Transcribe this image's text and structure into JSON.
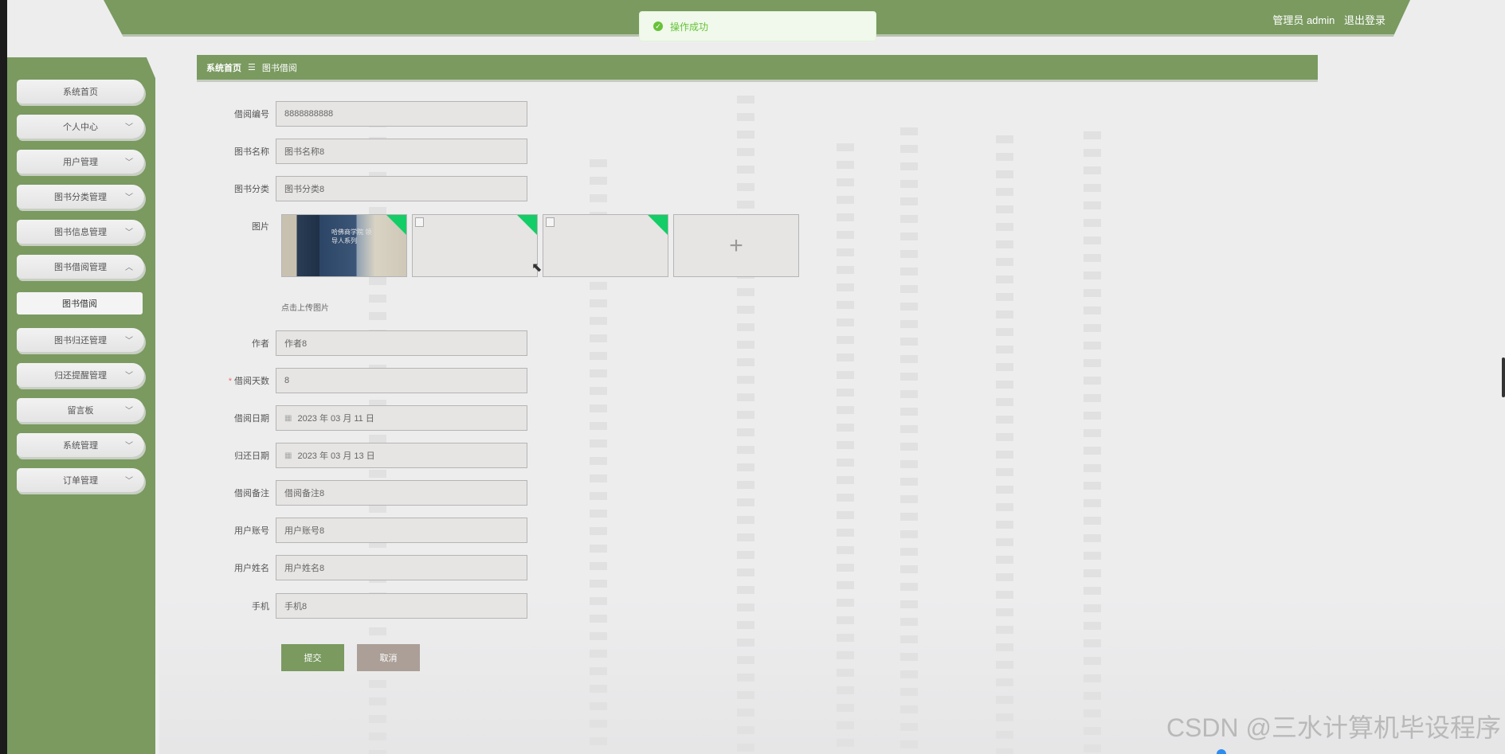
{
  "header": {
    "user_label": "管理员 admin",
    "logout": "退出登录"
  },
  "toast": {
    "message": "操作成功"
  },
  "sidebar": {
    "items": [
      {
        "label": "系统首页",
        "chevron": ""
      },
      {
        "label": "个人中心",
        "chevron": "﹀"
      },
      {
        "label": "用户管理",
        "chevron": "﹀"
      },
      {
        "label": "图书分类管理",
        "chevron": "﹀"
      },
      {
        "label": "图书信息管理",
        "chevron": "﹀"
      },
      {
        "label": "图书借阅管理",
        "chevron": "︿"
      },
      {
        "label": "图书借阅",
        "chevron": ""
      },
      {
        "label": "图书归还管理",
        "chevron": "﹀"
      },
      {
        "label": "归还提醒管理",
        "chevron": "﹀"
      },
      {
        "label": "留言板",
        "chevron": "﹀"
      },
      {
        "label": "系统管理",
        "chevron": "﹀"
      },
      {
        "label": "订单管理",
        "chevron": "﹀"
      }
    ]
  },
  "breadcrumb": {
    "home": "系统首页",
    "separator": "☰",
    "current": "图书借阅"
  },
  "form": {
    "borrow_no": {
      "label": "借阅编号",
      "value": "8888888888"
    },
    "book_name": {
      "label": "图书名称",
      "value": "图书名称8"
    },
    "book_category": {
      "label": "图书分类",
      "value": "图书分类8"
    },
    "images": {
      "label": "图片",
      "upload_hint": "点击上传图片",
      "add_symbol": "+",
      "book_cover_text": "哈佛商学院 领导人系列"
    },
    "author": {
      "label": "作者",
      "value": "作者8"
    },
    "borrow_days": {
      "label": "借阅天数",
      "required_mark": "*",
      "value": "8"
    },
    "borrow_date": {
      "label": "借阅日期",
      "value": "2023 年 03 月 11 日"
    },
    "return_date": {
      "label": "归还日期",
      "value": "2023 年 03 月 13 日"
    },
    "borrow_note": {
      "label": "借阅备注",
      "value": "借阅备注8"
    },
    "user_account": {
      "label": "用户账号",
      "value": "用户账号8"
    },
    "user_name": {
      "label": "用户姓名",
      "value": "用户姓名8"
    },
    "phone": {
      "label": "手机",
      "value": "手机8"
    }
  },
  "buttons": {
    "submit": "提交",
    "cancel": "取消"
  },
  "watermark": "CSDN @三水计算机毕设程序",
  "colors": {
    "primary": "#7a9a60",
    "cancel": "#ab9f97",
    "success": "#67c23a",
    "flag": "#13ce66"
  }
}
